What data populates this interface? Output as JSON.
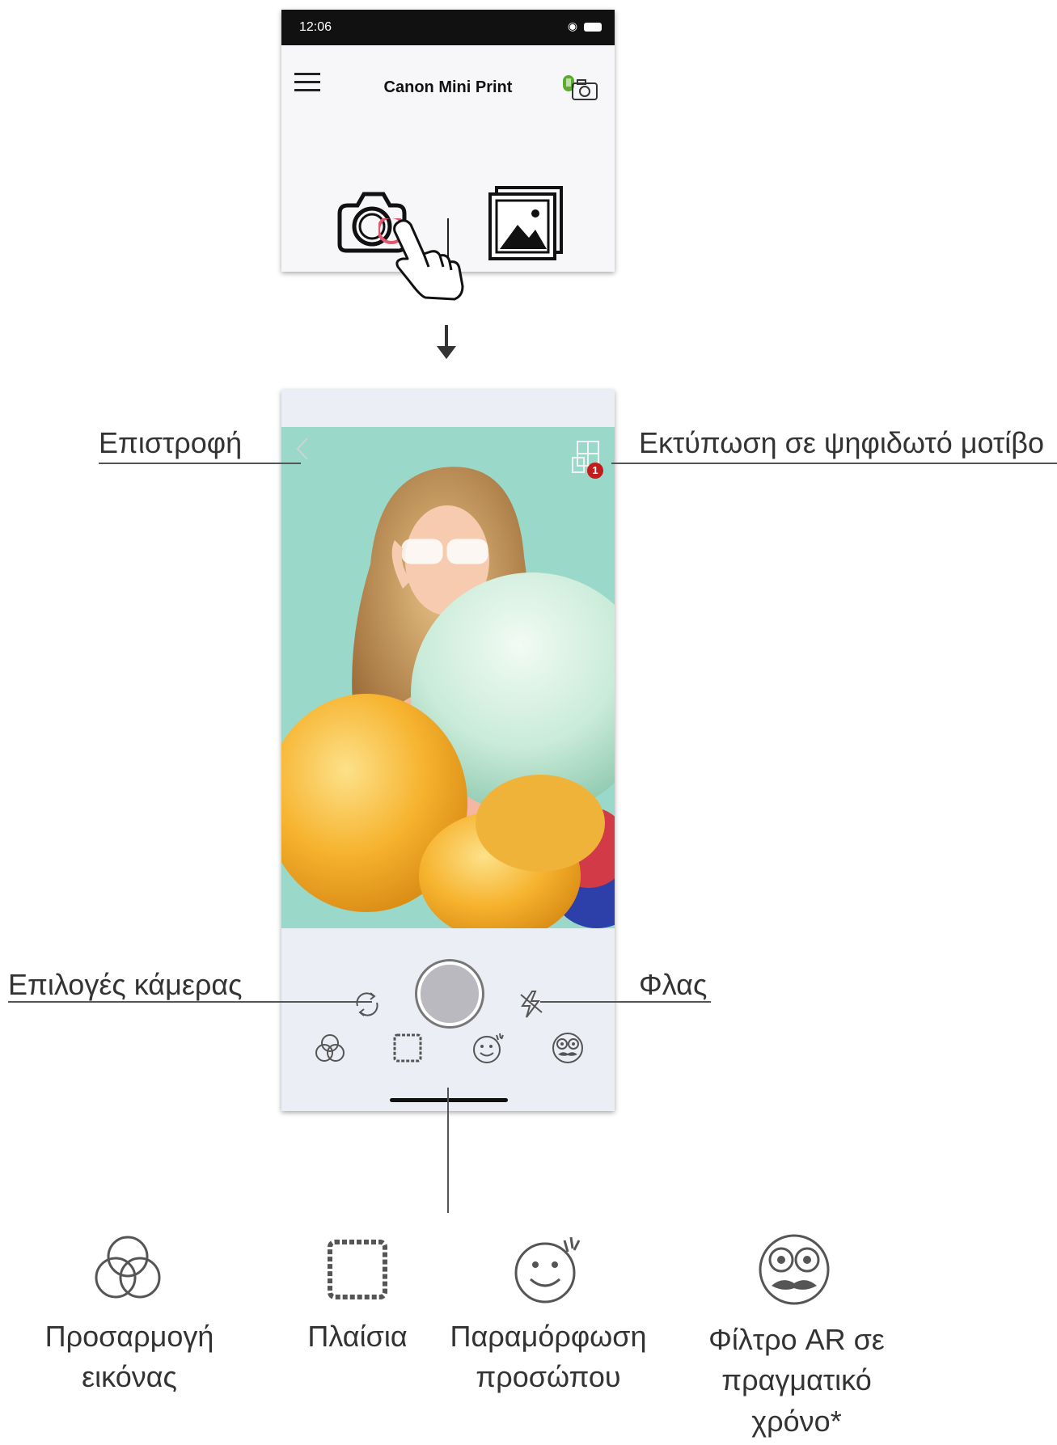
{
  "phone_top": {
    "status_time": "12:06",
    "app_title": "Canon Mini Print"
  },
  "phone_camera": {
    "mosaic_badge": "1"
  },
  "callouts": {
    "back": "Επιστροφή",
    "mosaic_print": "Εκτύπωση σε ψηφιδωτό μοτίβο",
    "camera_options": "Επιλογές κάμερας",
    "flash": "Φλας"
  },
  "legend": [
    {
      "icon": "adjustment-icon",
      "label": "Προσαρμογή εικόνας"
    },
    {
      "icon": "frames-icon",
      "label": "Πλαίσια"
    },
    {
      "icon": "face-distortion-icon",
      "label": "Παραμόρφωση προσώπου"
    },
    {
      "icon": "ar-filter-icon",
      "label": "Φίλτρο AR σε πραγματικό χρόνο*"
    }
  ],
  "colors": {
    "badge": "#c21c1c",
    "printer_status": "#5aab2e",
    "tap_highlight": "#e0566b"
  }
}
